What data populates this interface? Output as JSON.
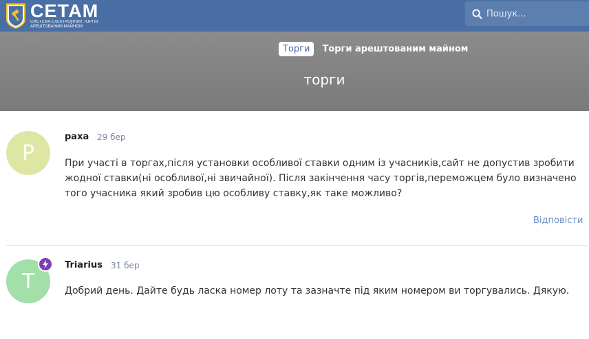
{
  "header": {
    "logo_title": "СЕТАМ",
    "logo_subtitle_1": "СИСТЕМА ЕЛЕКТРОННИХ ТОРГІВ",
    "logo_subtitle_2": "АРЕШТОВАНИМ МАЙНОМ",
    "search_placeholder": "Пошук..."
  },
  "hero": {
    "breadcrumb_tag": "Торги",
    "breadcrumb_title": "Торги арештованим майном",
    "page_title": "торги"
  },
  "comments": [
    {
      "avatar_letter": "P",
      "avatar_color": "#dde6a3",
      "author": "раха",
      "date": "29 бер",
      "text": "При участі в торгах,після установки особливої ставки одним із учасників,сайт не допустив зробити жодної ставки(ні особливої,ні звичайної). Після закінчення часу торгів,переможцем було визначено того учасника який зробив цю особливу ставку,як таке можливо?",
      "reply_label": "Відповісти"
    },
    {
      "avatar_letter": "T",
      "avatar_color": "#a3dfa8",
      "author": "Triarius",
      "date": "31 бер",
      "text": "Добрий день. Дайте будь ласка номер лоту та зазначте під яким номером ви торгувались. Дякую.",
      "badge_icon": "lightning-icon",
      "badge_color": "#7b3fb3"
    }
  ]
}
